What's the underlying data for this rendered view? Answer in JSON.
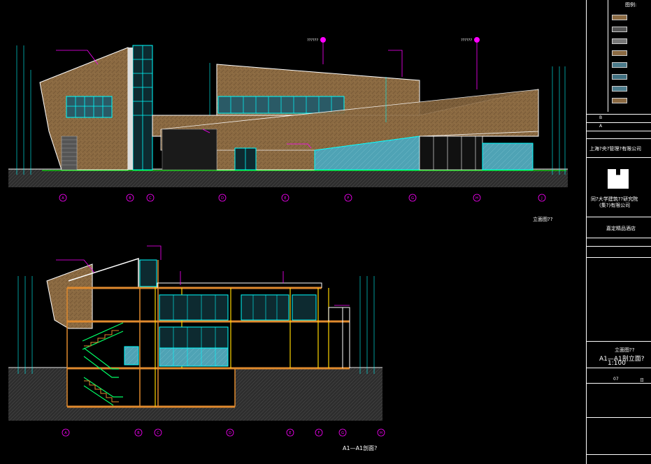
{
  "drawing": {
    "elevation_caption": "立面图??",
    "section_caption": "A1—A1剖面?",
    "grid_axis_top": [
      "A",
      "B",
      "C",
      "D",
      "E",
      "F",
      "G",
      "H",
      "J"
    ],
    "grid_axis_bottom": [
      "A",
      "B",
      "C",
      "D",
      "E",
      "F",
      "G",
      "H"
    ],
    "callout_1": "??????",
    "callout_2": "??????"
  },
  "title_block": {
    "legend_title": "图例:",
    "legend_swatches": [
      "#8b6a42",
      "#555555",
      "#777777",
      "#8b6a42",
      "#4a7a8a",
      "#3f6f80",
      "#4c7c8c",
      "#8b6a42"
    ],
    "rev_b": "B",
    "rev_a": "A",
    "owner": "上海?央?管理?有限公司",
    "institute_line1": "同?大学建筑??研究院",
    "institute_line2": "(集?)有限公司",
    "project_name": "嘉定精品酒店",
    "drawing_title_1": "立面图??",
    "drawing_title_2": "A1—A1剖立面?",
    "scale": "1:100",
    "sheet_no": "07",
    "date_code": "日"
  },
  "colors": {
    "cladding": "#8b6a42",
    "glass": "#4fa3b5",
    "accent_magenta": "#ff00ff",
    "accent_cyan": "#00ffff",
    "ground": "#3a3a3a",
    "slab": "#e08a2e",
    "stair": "#00ff66"
  }
}
